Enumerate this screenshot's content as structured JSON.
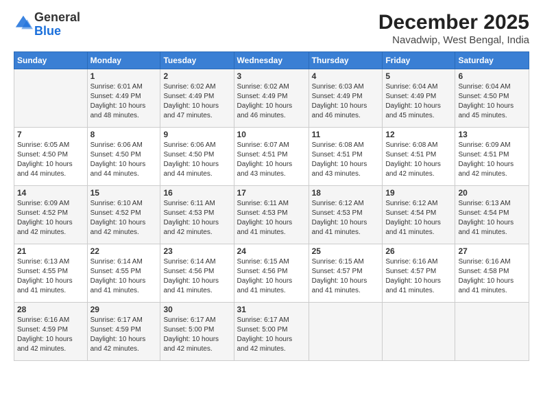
{
  "logo": {
    "text_general": "General",
    "text_blue": "Blue"
  },
  "header": {
    "title": "December 2025",
    "subtitle": "Navadwip, West Bengal, India"
  },
  "calendar": {
    "days_of_week": [
      "Sunday",
      "Monday",
      "Tuesday",
      "Wednesday",
      "Thursday",
      "Friday",
      "Saturday"
    ],
    "weeks": [
      [
        {
          "day": "",
          "sunrise": "",
          "sunset": "",
          "daylight": ""
        },
        {
          "day": "1",
          "sunrise": "Sunrise: 6:01 AM",
          "sunset": "Sunset: 4:49 PM",
          "daylight": "Daylight: 10 hours and 48 minutes."
        },
        {
          "day": "2",
          "sunrise": "Sunrise: 6:02 AM",
          "sunset": "Sunset: 4:49 PM",
          "daylight": "Daylight: 10 hours and 47 minutes."
        },
        {
          "day": "3",
          "sunrise": "Sunrise: 6:02 AM",
          "sunset": "Sunset: 4:49 PM",
          "daylight": "Daylight: 10 hours and 46 minutes."
        },
        {
          "day": "4",
          "sunrise": "Sunrise: 6:03 AM",
          "sunset": "Sunset: 4:49 PM",
          "daylight": "Daylight: 10 hours and 46 minutes."
        },
        {
          "day": "5",
          "sunrise": "Sunrise: 6:04 AM",
          "sunset": "Sunset: 4:49 PM",
          "daylight": "Daylight: 10 hours and 45 minutes."
        },
        {
          "day": "6",
          "sunrise": "Sunrise: 6:04 AM",
          "sunset": "Sunset: 4:50 PM",
          "daylight": "Daylight: 10 hours and 45 minutes."
        }
      ],
      [
        {
          "day": "7",
          "sunrise": "Sunrise: 6:05 AM",
          "sunset": "Sunset: 4:50 PM",
          "daylight": "Daylight: 10 hours and 44 minutes."
        },
        {
          "day": "8",
          "sunrise": "Sunrise: 6:06 AM",
          "sunset": "Sunset: 4:50 PM",
          "daylight": "Daylight: 10 hours and 44 minutes."
        },
        {
          "day": "9",
          "sunrise": "Sunrise: 6:06 AM",
          "sunset": "Sunset: 4:50 PM",
          "daylight": "Daylight: 10 hours and 44 minutes."
        },
        {
          "day": "10",
          "sunrise": "Sunrise: 6:07 AM",
          "sunset": "Sunset: 4:51 PM",
          "daylight": "Daylight: 10 hours and 43 minutes."
        },
        {
          "day": "11",
          "sunrise": "Sunrise: 6:08 AM",
          "sunset": "Sunset: 4:51 PM",
          "daylight": "Daylight: 10 hours and 43 minutes."
        },
        {
          "day": "12",
          "sunrise": "Sunrise: 6:08 AM",
          "sunset": "Sunset: 4:51 PM",
          "daylight": "Daylight: 10 hours and 42 minutes."
        },
        {
          "day": "13",
          "sunrise": "Sunrise: 6:09 AM",
          "sunset": "Sunset: 4:51 PM",
          "daylight": "Daylight: 10 hours and 42 minutes."
        }
      ],
      [
        {
          "day": "14",
          "sunrise": "Sunrise: 6:09 AM",
          "sunset": "Sunset: 4:52 PM",
          "daylight": "Daylight: 10 hours and 42 minutes."
        },
        {
          "day": "15",
          "sunrise": "Sunrise: 6:10 AM",
          "sunset": "Sunset: 4:52 PM",
          "daylight": "Daylight: 10 hours and 42 minutes."
        },
        {
          "day": "16",
          "sunrise": "Sunrise: 6:11 AM",
          "sunset": "Sunset: 4:53 PM",
          "daylight": "Daylight: 10 hours and 42 minutes."
        },
        {
          "day": "17",
          "sunrise": "Sunrise: 6:11 AM",
          "sunset": "Sunset: 4:53 PM",
          "daylight": "Daylight: 10 hours and 41 minutes."
        },
        {
          "day": "18",
          "sunrise": "Sunrise: 6:12 AM",
          "sunset": "Sunset: 4:53 PM",
          "daylight": "Daylight: 10 hours and 41 minutes."
        },
        {
          "day": "19",
          "sunrise": "Sunrise: 6:12 AM",
          "sunset": "Sunset: 4:54 PM",
          "daylight": "Daylight: 10 hours and 41 minutes."
        },
        {
          "day": "20",
          "sunrise": "Sunrise: 6:13 AM",
          "sunset": "Sunset: 4:54 PM",
          "daylight": "Daylight: 10 hours and 41 minutes."
        }
      ],
      [
        {
          "day": "21",
          "sunrise": "Sunrise: 6:13 AM",
          "sunset": "Sunset: 4:55 PM",
          "daylight": "Daylight: 10 hours and 41 minutes."
        },
        {
          "day": "22",
          "sunrise": "Sunrise: 6:14 AM",
          "sunset": "Sunset: 4:55 PM",
          "daylight": "Daylight: 10 hours and 41 minutes."
        },
        {
          "day": "23",
          "sunrise": "Sunrise: 6:14 AM",
          "sunset": "Sunset: 4:56 PM",
          "daylight": "Daylight: 10 hours and 41 minutes."
        },
        {
          "day": "24",
          "sunrise": "Sunrise: 6:15 AM",
          "sunset": "Sunset: 4:56 PM",
          "daylight": "Daylight: 10 hours and 41 minutes."
        },
        {
          "day": "25",
          "sunrise": "Sunrise: 6:15 AM",
          "sunset": "Sunset: 4:57 PM",
          "daylight": "Daylight: 10 hours and 41 minutes."
        },
        {
          "day": "26",
          "sunrise": "Sunrise: 6:16 AM",
          "sunset": "Sunset: 4:57 PM",
          "daylight": "Daylight: 10 hours and 41 minutes."
        },
        {
          "day": "27",
          "sunrise": "Sunrise: 6:16 AM",
          "sunset": "Sunset: 4:58 PM",
          "daylight": "Daylight: 10 hours and 41 minutes."
        }
      ],
      [
        {
          "day": "28",
          "sunrise": "Sunrise: 6:16 AM",
          "sunset": "Sunset: 4:59 PM",
          "daylight": "Daylight: 10 hours and 42 minutes."
        },
        {
          "day": "29",
          "sunrise": "Sunrise: 6:17 AM",
          "sunset": "Sunset: 4:59 PM",
          "daylight": "Daylight: 10 hours and 42 minutes."
        },
        {
          "day": "30",
          "sunrise": "Sunrise: 6:17 AM",
          "sunset": "Sunset: 5:00 PM",
          "daylight": "Daylight: 10 hours and 42 minutes."
        },
        {
          "day": "31",
          "sunrise": "Sunrise: 6:17 AM",
          "sunset": "Sunset: 5:00 PM",
          "daylight": "Daylight: 10 hours and 42 minutes."
        },
        {
          "day": "",
          "sunrise": "",
          "sunset": "",
          "daylight": ""
        },
        {
          "day": "",
          "sunrise": "",
          "sunset": "",
          "daylight": ""
        },
        {
          "day": "",
          "sunrise": "",
          "sunset": "",
          "daylight": ""
        }
      ]
    ]
  }
}
